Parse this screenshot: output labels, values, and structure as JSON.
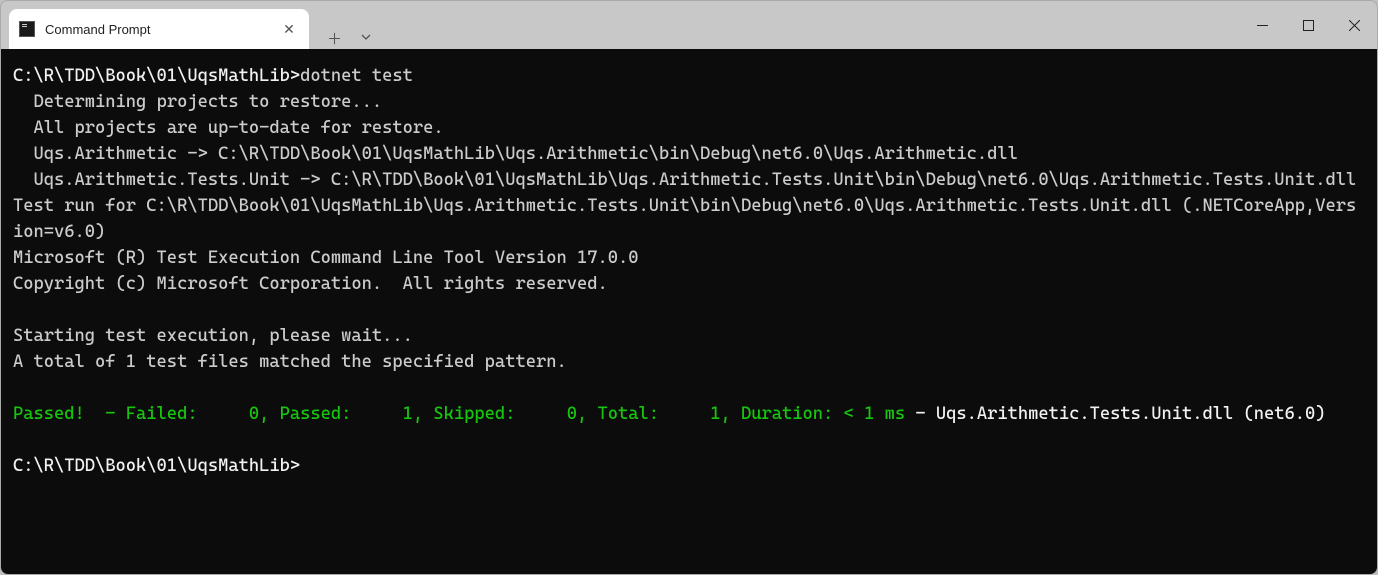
{
  "tab": {
    "title": "Command Prompt"
  },
  "terminal": {
    "prompt1": "C:\\R\\TDD\\Book\\01\\UqsMathLib>",
    "command": "dotnet test",
    "line_determining": "  Determining projects to restore...",
    "line_uptodate": "  All projects are up-to-date for restore.",
    "line_build1": "  Uqs.Arithmetic -> C:\\R\\TDD\\Book\\01\\UqsMathLib\\Uqs.Arithmetic\\bin\\Debug\\net6.0\\Uqs.Arithmetic.dll",
    "line_build2": "  Uqs.Arithmetic.Tests.Unit -> C:\\R\\TDD\\Book\\01\\UqsMathLib\\Uqs.Arithmetic.Tests.Unit\\bin\\Debug\\net6.0\\Uqs.Arithmetic.Tests.Unit.dll",
    "line_testrun": "Test run for C:\\R\\TDD\\Book\\01\\UqsMathLib\\Uqs.Arithmetic.Tests.Unit\\bin\\Debug\\net6.0\\Uqs.Arithmetic.Tests.Unit.dll (.NETCoreApp,Version=v6.0)",
    "line_msver": "Microsoft (R) Test Execution Command Line Tool Version 17.0.0",
    "line_copyright": "Copyright (c) Microsoft Corporation.  All rights reserved.",
    "line_starting": "Starting test execution, please wait...",
    "line_matched": "A total of 1 test files matched the specified pattern.",
    "result_green": "Passed!  - Failed:     0, Passed:     1, Skipped:     0, Total:     1, Duration: < 1 ms",
    "result_white": " - Uqs.Arithmetic.Tests.Unit.dll (net6.0)",
    "prompt2": "C:\\R\\TDD\\Book\\01\\UqsMathLib>"
  }
}
